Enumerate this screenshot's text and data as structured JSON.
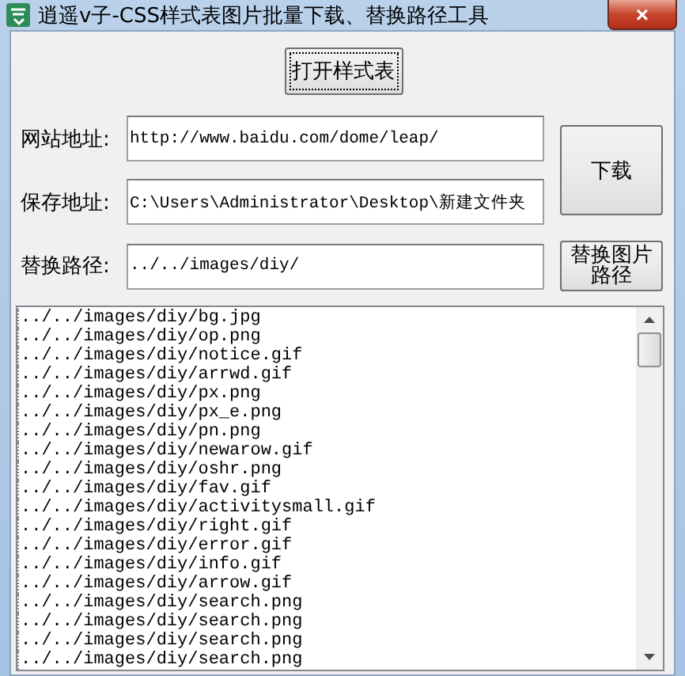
{
  "window": {
    "title": "逍遥v子-CSS样式表图片批量下载、替换路径工具",
    "close": "×"
  },
  "open_button": "打开样式表",
  "fields": [
    {
      "label": "网站地址:",
      "value": "http://www.baidu.com/dome/leap/"
    },
    {
      "label": "保存地址:",
      "value": "C:\\Users\\Administrator\\Desktop\\新建文件夹"
    },
    {
      "label": "替换路径:",
      "value": "../../images/diy/"
    }
  ],
  "download_button": "下载",
  "replace_button": "替换图片路径",
  "list": [
    "../../images/diy/bg.jpg",
    "../../images/diy/op.png",
    "../../images/diy/notice.gif",
    "../../images/diy/arrwd.gif",
    "../../images/diy/px.png",
    "../../images/diy/px_e.png",
    "../../images/diy/pn.png",
    "../../images/diy/newarow.gif",
    "../../images/diy/oshr.png",
    "../../images/diy/fav.gif",
    "../../images/diy/activitysmall.gif",
    "../../images/diy/right.gif",
    "../../images/diy/error.gif",
    "../../images/diy/info.gif",
    "../../images/diy/arrow.gif",
    "../../images/diy/search.png",
    "../../images/diy/search.png",
    "../../images/diy/search.png",
    "../../images/diy/search.png"
  ]
}
